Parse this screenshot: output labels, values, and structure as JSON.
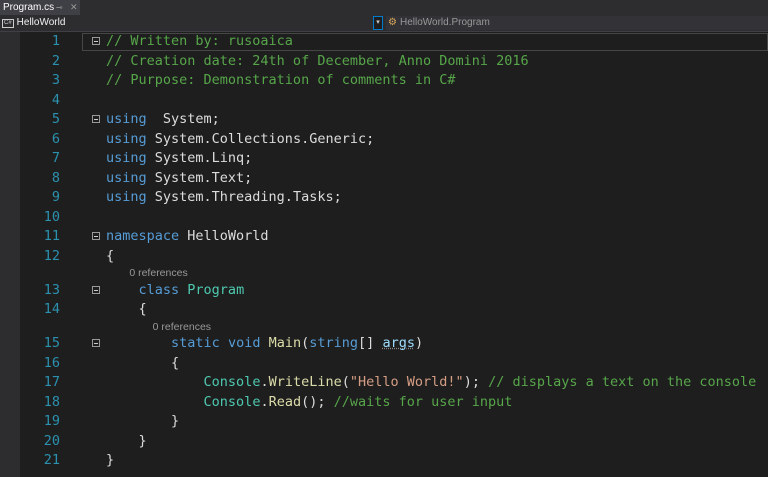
{
  "tab": {
    "title": "Program.cs",
    "pin": "⊸",
    "close": "✕"
  },
  "nav": {
    "project_icon": "C#",
    "project": "HelloWorld",
    "dropdown": "▾",
    "class_icon": "⚙",
    "class": "HelloWorld.Program"
  },
  "colors": {
    "comment": "#57a64a",
    "keyword": "#569cd6",
    "type": "#4ec9b0",
    "string": "#d69d85",
    "method": "#dcdcaa",
    "line_number": "#2b91af"
  },
  "lines": [
    {
      "n": "1",
      "fold": true,
      "tokens": [
        [
          "c",
          "// Written by: rusoaica"
        ]
      ]
    },
    {
      "n": "2",
      "tokens": [
        [
          "c",
          "// Creation date: 24th of December, Anno Domini 2016"
        ]
      ]
    },
    {
      "n": "3",
      "tokens": [
        [
          "c",
          "// Purpose: Demonstration of comments in C#"
        ]
      ]
    },
    {
      "n": "4",
      "tokens": []
    },
    {
      "n": "5",
      "fold": true,
      "tokens": [
        [
          "k",
          "using"
        ],
        [
          "",
          "  System;"
        ]
      ]
    },
    {
      "n": "6",
      "tokens": [
        [
          "k",
          "using"
        ],
        [
          "",
          " System.Collections.Generic;"
        ]
      ]
    },
    {
      "n": "7",
      "tokens": [
        [
          "k",
          "using"
        ],
        [
          "",
          " System.Linq;"
        ]
      ]
    },
    {
      "n": "8",
      "tokens": [
        [
          "k",
          "using"
        ],
        [
          "",
          " System.Text;"
        ]
      ]
    },
    {
      "n": "9",
      "tokens": [
        [
          "k",
          "using"
        ],
        [
          "",
          " System.Threading.Tasks;"
        ]
      ]
    },
    {
      "n": "10",
      "tokens": []
    },
    {
      "n": "11",
      "fold": true,
      "tokens": [
        [
          "k",
          "namespace"
        ],
        [
          "",
          " HelloWorld"
        ]
      ]
    },
    {
      "n": "12",
      "tokens": [
        [
          "",
          "{"
        ]
      ]
    },
    {
      "lens": "        0 references"
    },
    {
      "n": "13",
      "fold": true,
      "tokens": [
        [
          "",
          "    "
        ],
        [
          "k",
          "class"
        ],
        [
          "",
          " "
        ],
        [
          "t",
          "Program"
        ]
      ]
    },
    {
      "n": "14",
      "tokens": [
        [
          "",
          "    {"
        ]
      ]
    },
    {
      "lens": "                0 references"
    },
    {
      "n": "15",
      "fold": true,
      "tokens": [
        [
          "",
          "        "
        ],
        [
          "k",
          "static"
        ],
        [
          "",
          " "
        ],
        [
          "k",
          "void"
        ],
        [
          "",
          " "
        ],
        [
          "m",
          "Main"
        ],
        [
          "",
          "("
        ],
        [
          "k",
          "string"
        ],
        [
          "",
          "[] "
        ],
        [
          "p",
          "args"
        ],
        [
          "",
          ")"
        ]
      ]
    },
    {
      "n": "16",
      "tokens": [
        [
          "",
          "        {"
        ]
      ]
    },
    {
      "n": "17",
      "tokens": [
        [
          "",
          "            "
        ],
        [
          "t",
          "Console"
        ],
        [
          "",
          "."
        ],
        [
          "m",
          "WriteLine"
        ],
        [
          "",
          "("
        ],
        [
          "s",
          "\"Hello World!\""
        ],
        [
          "",
          "); "
        ],
        [
          "c",
          "// displays a text on the console"
        ]
      ]
    },
    {
      "n": "18",
      "tokens": [
        [
          "",
          "            "
        ],
        [
          "t",
          "Console"
        ],
        [
          "",
          "."
        ],
        [
          "m",
          "Read"
        ],
        [
          "",
          "(); "
        ],
        [
          "c",
          "//waits for user input"
        ]
      ]
    },
    {
      "n": "19",
      "tokens": [
        [
          "",
          "        }"
        ]
      ]
    },
    {
      "n": "20",
      "tokens": [
        [
          "",
          "    }"
        ]
      ]
    },
    {
      "n": "21",
      "tokens": [
        [
          "",
          "}"
        ]
      ]
    }
  ]
}
